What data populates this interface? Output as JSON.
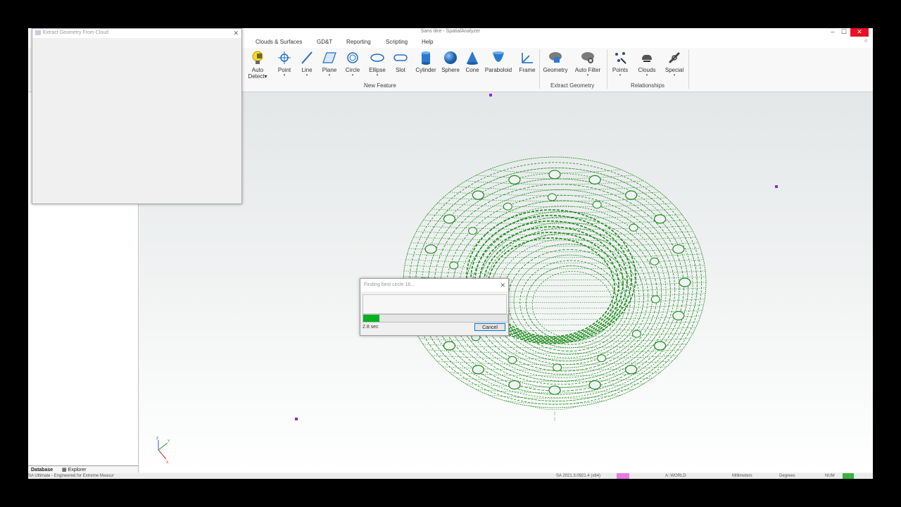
{
  "window": {
    "title": "Sans titre - SpatialAnalyzer"
  },
  "menu": [
    "Clouds & Surfaces",
    "GD&T",
    "Reporting",
    "Scripting",
    "Help"
  ],
  "ribbon": {
    "buttons": [
      {
        "label": "Auto",
        "label2": "Detect",
        "icon": "auto-detect-icon"
      },
      {
        "label": "Point",
        "icon": "point-icon"
      },
      {
        "label": "Line",
        "icon": "line-icon"
      },
      {
        "label": "Plane",
        "icon": "plane-icon"
      },
      {
        "label": "Circle",
        "icon": "circle-icon"
      },
      {
        "label": "Ellipse",
        "icon": "ellipse-icon"
      },
      {
        "label": "Slot",
        "icon": "slot-icon"
      },
      {
        "label": "Cylinder",
        "icon": "cylinder-icon"
      },
      {
        "label": "Sphere",
        "icon": "sphere-icon"
      },
      {
        "label": "Cone",
        "icon": "cone-icon"
      },
      {
        "label": "Paraboloid",
        "icon": "paraboloid-icon"
      },
      {
        "label": "Frame",
        "icon": "frame-icon"
      },
      {
        "label": "Geometry",
        "icon": "cloud-geometry-icon"
      },
      {
        "label": "Auto Filter",
        "icon": "cloud-filter-icon"
      },
      {
        "label": "Points",
        "icon": "points-relationship-icon"
      },
      {
        "label": "Clouds",
        "icon": "clouds-relationship-icon"
      },
      {
        "label": "Special",
        "icon": "special-relationship-icon"
      }
    ],
    "groups": [
      "New Feature",
      "Extract Geometry",
      "Relationships"
    ]
  },
  "extract_dialog": {
    "title": "Extract Geometry From Cloud"
  },
  "progress_dialog": {
    "title": "Finding best circle 16...",
    "progress": 0.11,
    "elapsed": "2.8 sec",
    "cancel_label": "Cancel"
  },
  "tabs": [
    "Database",
    "Explorer"
  ],
  "status": {
    "left": "SA Ultimate - Engineered for Extreme Measur",
    "version": "SA 2021.3.0921.4 (x64)",
    "frame": "A::WORLD",
    "units_length": "Millimeters",
    "units_angle": "Degrees",
    "num": "NUM"
  },
  "colors": {
    "cloud": "#1d8a1d",
    "marker": "#8b2bd9",
    "progress": "#06b025"
  }
}
